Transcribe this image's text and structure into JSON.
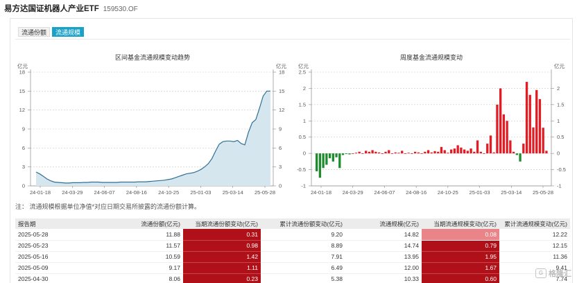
{
  "header": {
    "fund_name": "易方达国证机器人产业ETF",
    "fund_code": "159530.OF"
  },
  "tabs": [
    {
      "label": "流通份额",
      "active": false
    },
    {
      "label": "流通规模",
      "active": true
    }
  ],
  "note": "注：  流通规模根据单位净值*对应日期交易所披露的流通份额计算。",
  "table": {
    "headers": [
      "报告期",
      "流通份额(亿元)",
      "当期流通份额变动(亿元)",
      "累计流通份额变动(亿元)",
      "流通规模(亿元)",
      "当期流通规模变动(亿元)",
      "累计流通规模变动(亿元)"
    ],
    "rows": [
      [
        "2025-05-28",
        "11.88",
        "0.31",
        "9.20",
        "14.82",
        "0.08",
        "12.22"
      ],
      [
        "2025-05-23",
        "11.57",
        "0.98",
        "8.89",
        "14.74",
        "0.79",
        "12.15"
      ],
      [
        "2025-05-16",
        "10.59",
        "1.42",
        "7.91",
        "13.95",
        "1.95",
        "11.36"
      ],
      [
        "2025-05-09",
        "9.17",
        "1.11",
        "6.49",
        "12.00",
        "1.67",
        "9.41"
      ],
      [
        "2025-04-30",
        "8.06",
        "0.23",
        "5.38",
        "10.33",
        "0.60",
        "7.74"
      ]
    ]
  },
  "watermark": {
    "logo": "G",
    "text": "格隆汇"
  },
  "colors": {
    "accent": "#1aa1c7",
    "area_fill": "#d5e6ef",
    "area_line": "#2f6f95",
    "bar_up": "#e41b23",
    "bar_down": "#1e8c2d",
    "cell_red": "#b01118",
    "cell_pink": "#e98589"
  },
  "chart_data": [
    {
      "type": "area",
      "title": "区间基金流通规模变动趋势",
      "unit_left": "亿元",
      "unit_right": "亿元",
      "ylim": [
        0,
        18
      ],
      "yticks": [
        0,
        3,
        6,
        9,
        12,
        15,
        18
      ],
      "right_yticks": [
        0,
        3,
        6,
        9,
        12,
        15,
        18
      ],
      "xlabels": [
        "24-01-18",
        "24-03-29",
        "24-06-07",
        "24-08-16",
        "24-10-25",
        "25-01-03",
        "25-03-14",
        "25-05-28"
      ],
      "grid": true,
      "values": [
        2.2,
        1.9,
        1.5,
        1.1,
        0.8,
        0.6,
        0.55,
        0.5,
        0.45,
        0.45,
        0.5,
        0.5,
        0.5,
        0.55,
        0.55,
        0.6,
        0.6,
        0.6,
        0.55,
        0.55,
        0.55,
        0.55,
        0.55,
        0.6,
        0.6,
        0.6,
        0.6,
        0.6,
        0.65,
        0.65,
        0.65,
        0.7,
        0.75,
        0.8,
        0.85,
        0.9,
        1.0,
        1.1,
        1.3,
        1.5,
        1.7,
        1.9,
        2.0,
        2.1,
        2.3,
        2.6,
        3.0,
        3.5,
        4.3,
        5.5,
        6.6,
        7.0,
        7.1,
        7.1,
        7.0,
        7.2,
        6.7,
        6.5,
        8.5,
        10.0,
        10.5,
        12.3,
        14.2,
        15.0,
        15.0
      ]
    },
    {
      "type": "bar",
      "title": "周度基金流通规模变动",
      "unit_left": "亿元",
      "unit_right": "亿元",
      "ylim": [
        -1,
        2.5
      ],
      "yticks": [
        -1,
        -0.5,
        0,
        0.5,
        1,
        1.5,
        2,
        2.5
      ],
      "right_yticks": [
        -1,
        -0.5,
        0,
        0.5,
        1,
        1.5,
        2
      ],
      "xlabels": [
        "24-01-18",
        "24-03-29",
        "24-06-07",
        "24-08-16",
        "24-10-25",
        "25-01-03",
        "25-03-14",
        "25-05-28"
      ],
      "grid": true,
      "values": [
        -0.55,
        -0.75,
        -0.45,
        -0.35,
        -0.15,
        -0.25,
        -0.12,
        -0.45,
        -0.05,
        -0.02,
        -0.03,
        0.0,
        0.02,
        0.05,
        0.0,
        0.08,
        0.05,
        0.1,
        0.05,
        0.03,
        0.0,
        0.05,
        0.1,
        0.0,
        0.03,
        0.02,
        0.08,
        0.0,
        0.02,
        0.0,
        0.05,
        0.03,
        0.0,
        0.05,
        0.1,
        0.03,
        0.07,
        0.05,
        0.2,
        0.1,
        0.02,
        0.12,
        0.15,
        0.25,
        0.18,
        0.12,
        0.08,
        0.15,
        0.05,
        0.4,
        0.05,
        0.0,
        0.3,
        0.55,
        0.03,
        1.5,
        2.0,
        1.2,
        1.0,
        0.4,
        0.05,
        -0.05,
        -0.25,
        0.3,
        2.2,
        1.8,
        0.8,
        1.95,
        1.67,
        0.79,
        0.08
      ]
    }
  ]
}
